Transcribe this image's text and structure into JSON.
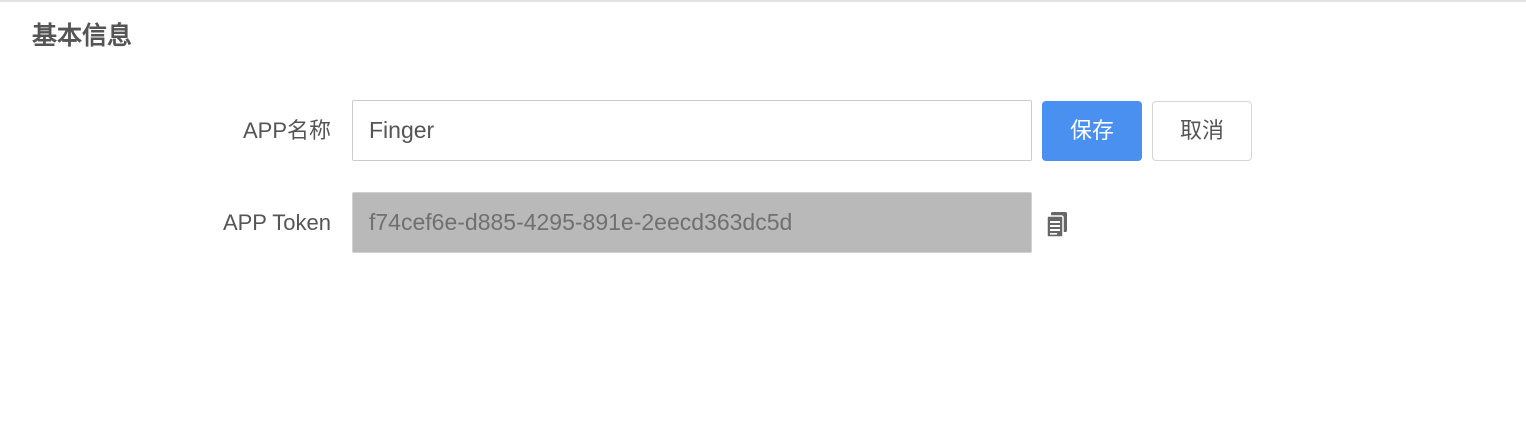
{
  "section": {
    "title": "基本信息"
  },
  "form": {
    "app_name_label": "APP名称",
    "app_name_value": "Finger",
    "app_token_label": "APP Token",
    "app_token_value": "f74cef6e-d885-4295-891e-2eecd363dc5d"
  },
  "buttons": {
    "save_label": "保存",
    "cancel_label": "取消"
  },
  "icons": {
    "copy": "copy-icon"
  },
  "colors": {
    "primary": "#4a90f0",
    "disabled_field": "#b9b9b9",
    "text": "#555555"
  }
}
